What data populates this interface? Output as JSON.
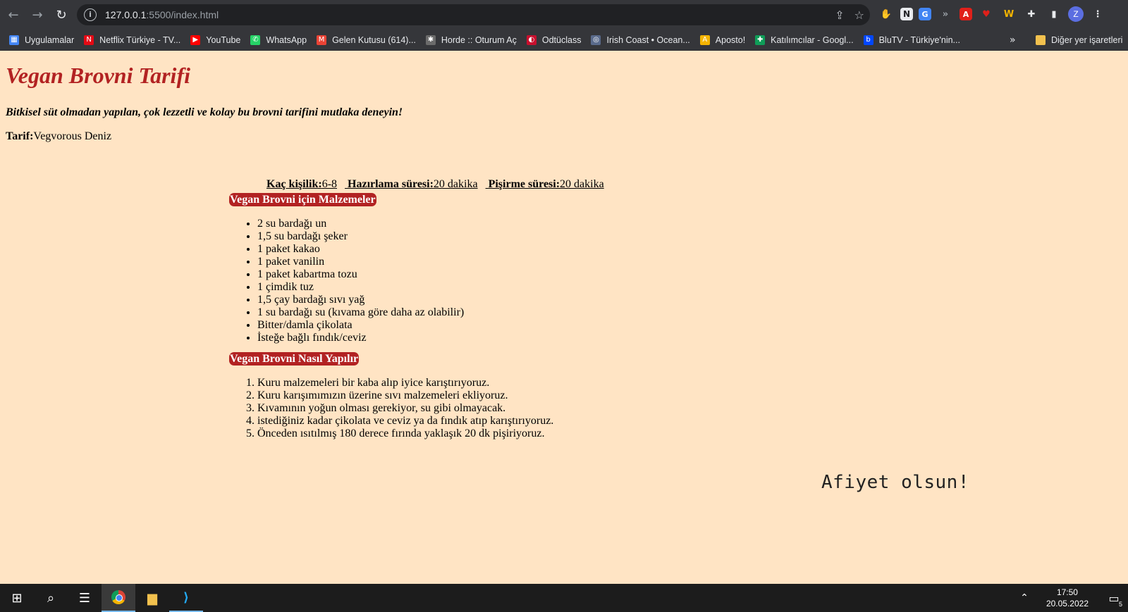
{
  "browser": {
    "url_host": "127.0.0.1",
    "url_path": ":5500/index.html",
    "profile_initial": "Z",
    "bookmarks": [
      {
        "label": "Uygulamalar",
        "icon": "apps-grid-icon",
        "color": "#4285f4",
        "glyph": "▦"
      },
      {
        "label": "Netflix Türkiye - TV...",
        "icon": "netflix-icon",
        "color": "#e50914",
        "glyph": "N"
      },
      {
        "label": "YouTube",
        "icon": "youtube-icon",
        "color": "#ff0000",
        "glyph": "▶"
      },
      {
        "label": "WhatsApp",
        "icon": "whatsapp-icon",
        "color": "#25d366",
        "glyph": "✆"
      },
      {
        "label": "Gelen Kutusu (614)...",
        "icon": "gmail-icon",
        "color": "#ea4335",
        "glyph": "M"
      },
      {
        "label": "Horde :: Oturum Aç",
        "icon": "horde-icon",
        "color": "#6b6b6b",
        "glyph": "✱"
      },
      {
        "label": "Odtüclass",
        "icon": "odtu-icon",
        "color": "#c8102e",
        "glyph": "◐"
      },
      {
        "label": "Irish Coast • Ocean...",
        "icon": "ocean-icon",
        "color": "#5a6b8c",
        "glyph": "◎"
      },
      {
        "label": "Aposto!",
        "icon": "aposto-icon",
        "color": "#f4b400",
        "glyph": "A"
      },
      {
        "label": "Katılımcılar - Googl...",
        "icon": "google-classroom-icon",
        "color": "#0f9d58",
        "glyph": "✚"
      },
      {
        "label": "BluTV - Türkiye'nin...",
        "icon": "blutv-icon",
        "color": "#0047ff",
        "glyph": "b"
      }
    ],
    "more_bookmarks": "»",
    "other_bookmarks": "Diğer yer işaretleri"
  },
  "recipe": {
    "title": "Vegan Brovni Tarifi",
    "subtitle": "Bitkisel süt olmadan yapılan, çok lezzetli ve kolay bu brovni tarifini mutlaka deneyin!",
    "author_label": "Tarif:",
    "author": "Vegvorous Deniz",
    "servings_label": "Kaç kişilik:",
    "servings": "6-8",
    "prep_label": "Hazırlama süresi:",
    "prep": "20 dakika",
    "cook_label": "Pişirme süresi:",
    "cook": "20 dakika",
    "ingredients_title": "Vegan Brovni için Malzemeler",
    "ingredients": [
      "2 su bardağı un",
      "1,5 su bardağı şeker",
      "1 paket kakao",
      "1 paket vanilin",
      "1 paket kabartma tozu",
      "1 çimdik tuz",
      "1,5 çay bardağı sıvı yağ",
      "1 su bardağı su (kıvama göre daha az olabilir)",
      "Bitter/damla çikolata",
      "İsteğe bağlı fındık/ceviz"
    ],
    "steps_title": "Vegan Brovni Nasıl Yapılır",
    "steps": [
      "Kuru malzemeleri bir kaba alıp iyice karıştırıyoruz.",
      "Kuru karışımımızın üzerine sıvı malzemeleri ekliyoruz.",
      "Kıvamının yoğun olması gerekiyor, su gibi olmayacak.",
      "istediğiniz kadar çikolata ve ceviz ya da fındık atıp karıştırıyoruz.",
      "Önceden ısıtılmış 180 derece fırında yaklaşık 20 dk pişiriyoruz."
    ],
    "closing": "Afiyet olsun!"
  },
  "taskbar": {
    "time": "17:50",
    "date": "20.05.2022",
    "notification_count": "5"
  }
}
